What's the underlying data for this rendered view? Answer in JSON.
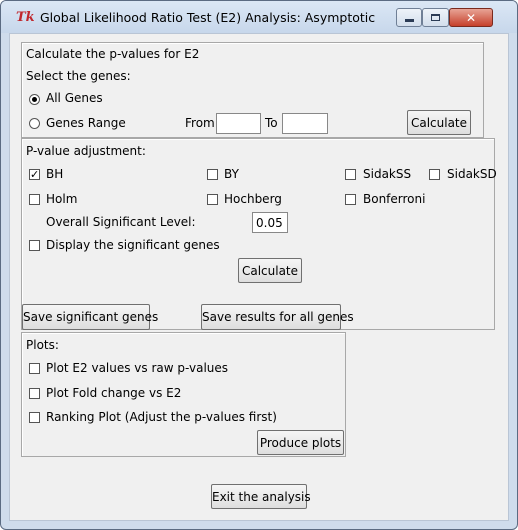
{
  "window": {
    "title": "Global Likelihood Ratio Test (E2) Analysis: Asymptotic",
    "app_icon": "Tk",
    "controls": {
      "minimize": "minimize-icon",
      "maximize": "maximize-icon",
      "close": "close-icon"
    }
  },
  "pvalues": {
    "heading": "Calculate the p-values for E2",
    "select_label": "Select the genes:",
    "all_genes_label": "All Genes",
    "genes_range_label": "Genes Range",
    "selected": "All Genes",
    "from_label": "From",
    "from_value": "",
    "to_label": "To",
    "to_value": "",
    "calculate_label": "Calculate"
  },
  "adjustment": {
    "heading": "P-value adjustment:",
    "methods": [
      {
        "label": "BH",
        "checked": true
      },
      {
        "label": "BY",
        "checked": false
      },
      {
        "label": "SidakSS",
        "checked": false
      },
      {
        "label": "SidakSD",
        "checked": false
      },
      {
        "label": "Holm",
        "checked": false
      },
      {
        "label": "Hochberg",
        "checked": false
      },
      {
        "label": "Bonferroni",
        "checked": false
      }
    ],
    "significance_label": "Overall Significant Level:",
    "significance_value": "0.05",
    "display_label": "Display the significant genes",
    "display_checked": false,
    "calculate_label": "Calculate",
    "save_significant_label": "Save significant genes",
    "save_all_label": "Save results for all genes"
  },
  "plots": {
    "heading": "Plots:",
    "options": [
      {
        "label": "Plot E2 values vs raw p-values",
        "checked": false
      },
      {
        "label": "Plot Fold change vs E2",
        "checked": false
      },
      {
        "label": "Ranking Plot (Adjust the p-values first)",
        "checked": false
      }
    ],
    "produce_label": "Produce plots"
  },
  "exit_label": "Exit the analysis"
}
